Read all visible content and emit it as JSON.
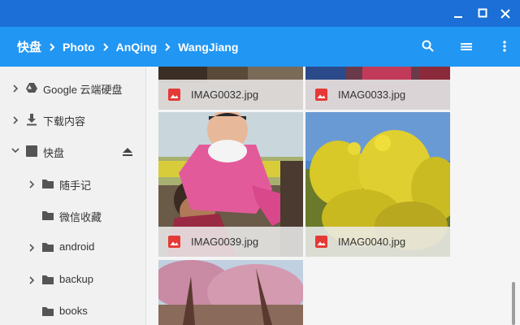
{
  "window": {
    "minimize": "minimize",
    "maximize": "maximize",
    "close": "close"
  },
  "breadcrumb": [
    "快盘",
    "Photo",
    "AnQing",
    "WangJiang"
  ],
  "toolbar": {
    "search_icon": "search-icon",
    "view_icon": "list-view-icon",
    "menu_icon": "more-vert-icon"
  },
  "sidebar": {
    "items": [
      {
        "label": "Google 云端硬盘",
        "icon": "drive-icon"
      },
      {
        "label": "下载内容",
        "icon": "download-icon"
      },
      {
        "label": "快盘",
        "icon": "drive-square-icon"
      },
      {
        "label": "随手记",
        "icon": "folder-icon"
      },
      {
        "label": "微信收藏",
        "icon": "folder-icon"
      },
      {
        "label": "android",
        "icon": "folder-icon"
      },
      {
        "label": "backup",
        "icon": "folder-icon"
      },
      {
        "label": "books",
        "icon": "folder-icon"
      }
    ]
  },
  "files": [
    {
      "name": "IMAG0032.jpg"
    },
    {
      "name": "IMAG0033.jpg"
    },
    {
      "name": "IMAG0039.jpg"
    },
    {
      "name": "IMAG0040.jpg"
    },
    {
      "name": ""
    }
  ],
  "colors": {
    "titlebar": "#1b6fd6",
    "toolbar": "#2196f3",
    "file_icon": "#e53935"
  }
}
